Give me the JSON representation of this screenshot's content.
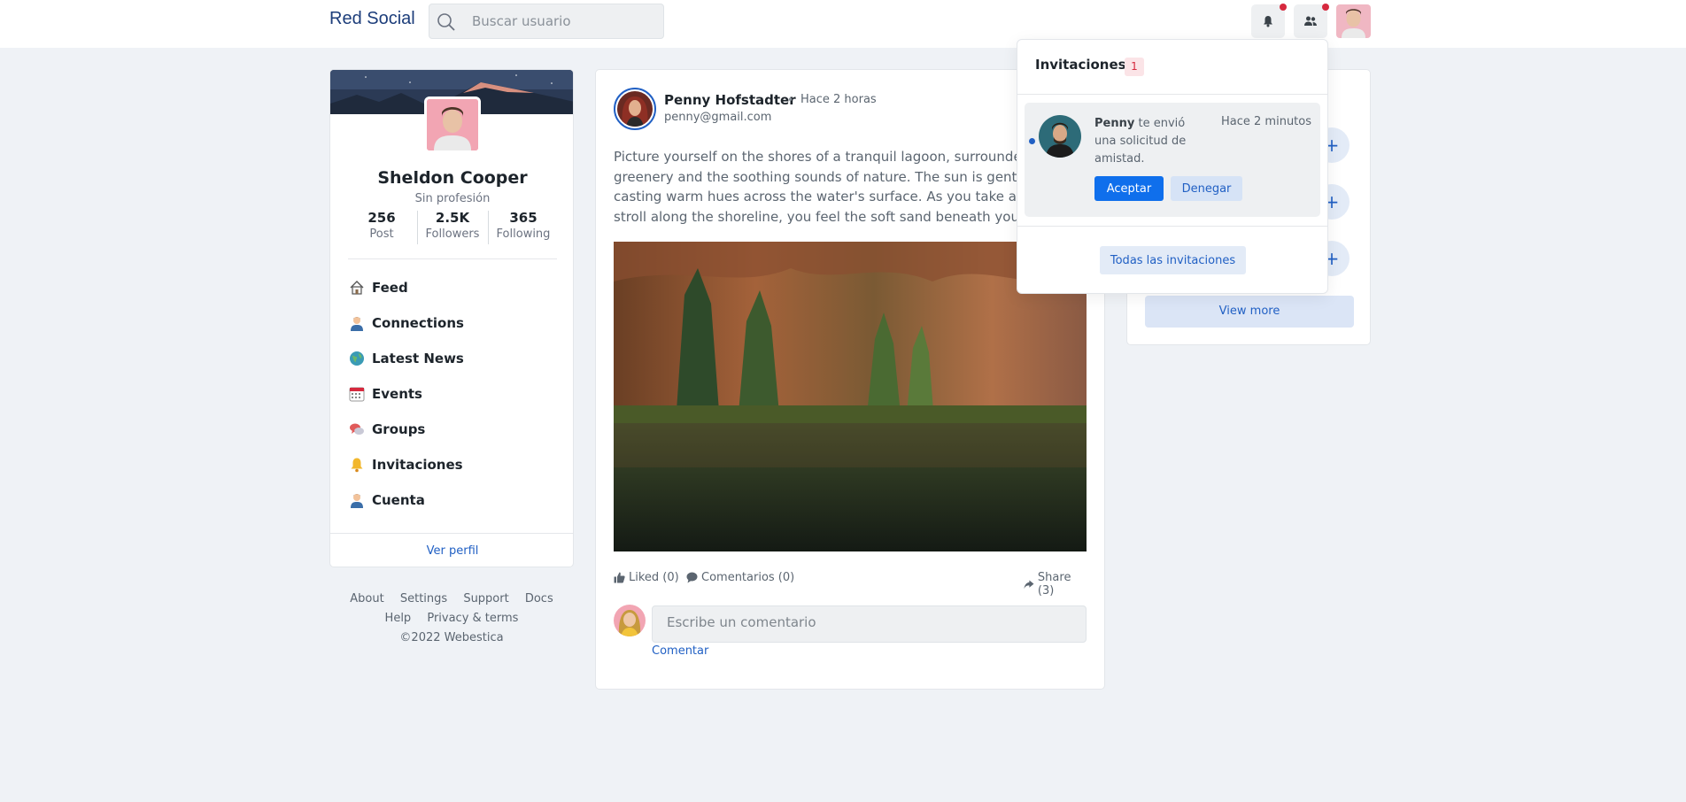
{
  "header": {
    "brand": "Red Social",
    "search_placeholder": "Buscar usuario"
  },
  "profile": {
    "name": "Sheldon Cooper",
    "profession": "Sin profesión",
    "stats": [
      {
        "value": "256",
        "label": "Post"
      },
      {
        "value": "2.5K",
        "label": "Followers"
      },
      {
        "value": "365",
        "label": "Following"
      }
    ],
    "menu": [
      {
        "label": "Feed",
        "icon": "home-icon"
      },
      {
        "label": "Connections",
        "icon": "person-icon"
      },
      {
        "label": "Latest News",
        "icon": "globe-icon"
      },
      {
        "label": "Events",
        "icon": "calendar-icon"
      },
      {
        "label": "Groups",
        "icon": "chat-bubbles-icon"
      },
      {
        "label": "Invitaciones",
        "icon": "bell-icon"
      },
      {
        "label": "Cuenta",
        "icon": "person-icon"
      }
    ],
    "view_profile": "Ver perfil"
  },
  "footer_links": {
    "about": "About",
    "settings": "Settings",
    "support": "Support",
    "docs": "Docs",
    "help": "Help",
    "privacy": "Privacy & terms",
    "copyright": "©2022 Webestica"
  },
  "post": {
    "author": "Penny Hofstadter",
    "separator": "•",
    "time": "Hace 2 horas",
    "email": "penny@gmail.com",
    "text": "Picture yourself on the shores of a tranquil lagoon, surrounded by greenery and the soothing sounds of nature. The sun is gently setting, casting warm hues across the water's surface. As you take a leisurely stroll along the shoreline, you feel the soft sand beneath your feet.",
    "liked": "Liked (0)",
    "comments": "Comentarios (0)",
    "share": "Share (3)",
    "comment_placeholder": "Escribe un comentario",
    "comment_submit": "Comentar"
  },
  "right_card": {
    "view_more": "View more",
    "add_symbol": "+"
  },
  "invitations_dropdown": {
    "title": "Invitaciones",
    "count": "1",
    "item": {
      "name": "Penny",
      "message": " te envió una solicitud de amistad.",
      "time": "Hace 2 minutos",
      "accept": "Aceptar",
      "deny": "Denegar"
    },
    "all": "Todas las invitaciones"
  },
  "colors": {
    "primary": "#0f6fec",
    "link": "#2160c4",
    "danger": "#d6293e",
    "background": "#eff2f6"
  }
}
